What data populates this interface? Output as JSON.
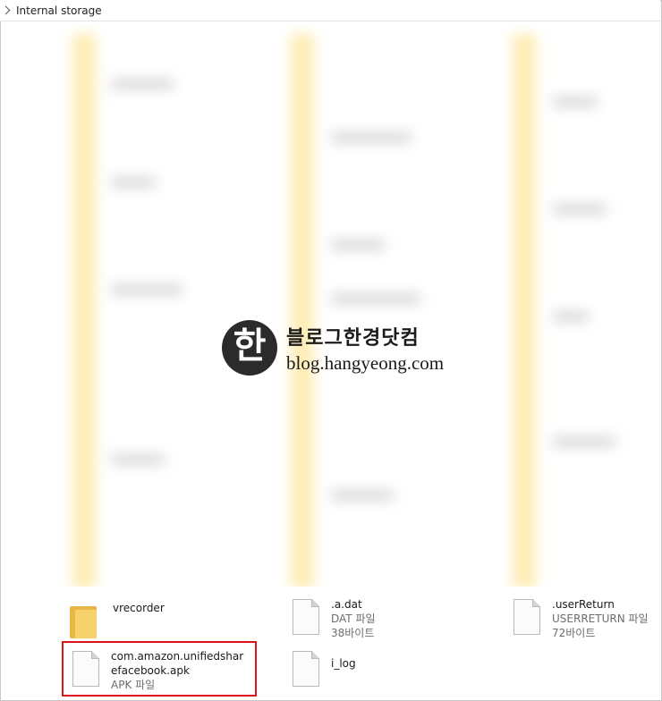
{
  "address_bar": {
    "crumb": "Internal storage"
  },
  "watermark": {
    "logo_glyph": "한",
    "korean": "블로그한경닷컴",
    "url": "blog.hangyeong.com"
  },
  "files": [
    {
      "name": "vrecorder",
      "type": "",
      "size": "",
      "icon": "folder-icon"
    },
    {
      "name": ".a.dat",
      "type": "DAT 파일",
      "size": "38바이트",
      "icon": "file-icon"
    },
    {
      "name": ".userReturn",
      "type": "USERRETURN 파일",
      "size": "72바이트",
      "icon": "file-icon"
    },
    {
      "name_line1": "com.amazon.unifiedshar",
      "name_line2": "efacebook.apk",
      "type": "APK 파일",
      "icon": "file-icon"
    },
    {
      "name": "i_log",
      "type": "",
      "size": "",
      "icon": "file-icon"
    }
  ],
  "colors": {
    "highlight": "#e0101c",
    "folder": "#f5d06b"
  }
}
